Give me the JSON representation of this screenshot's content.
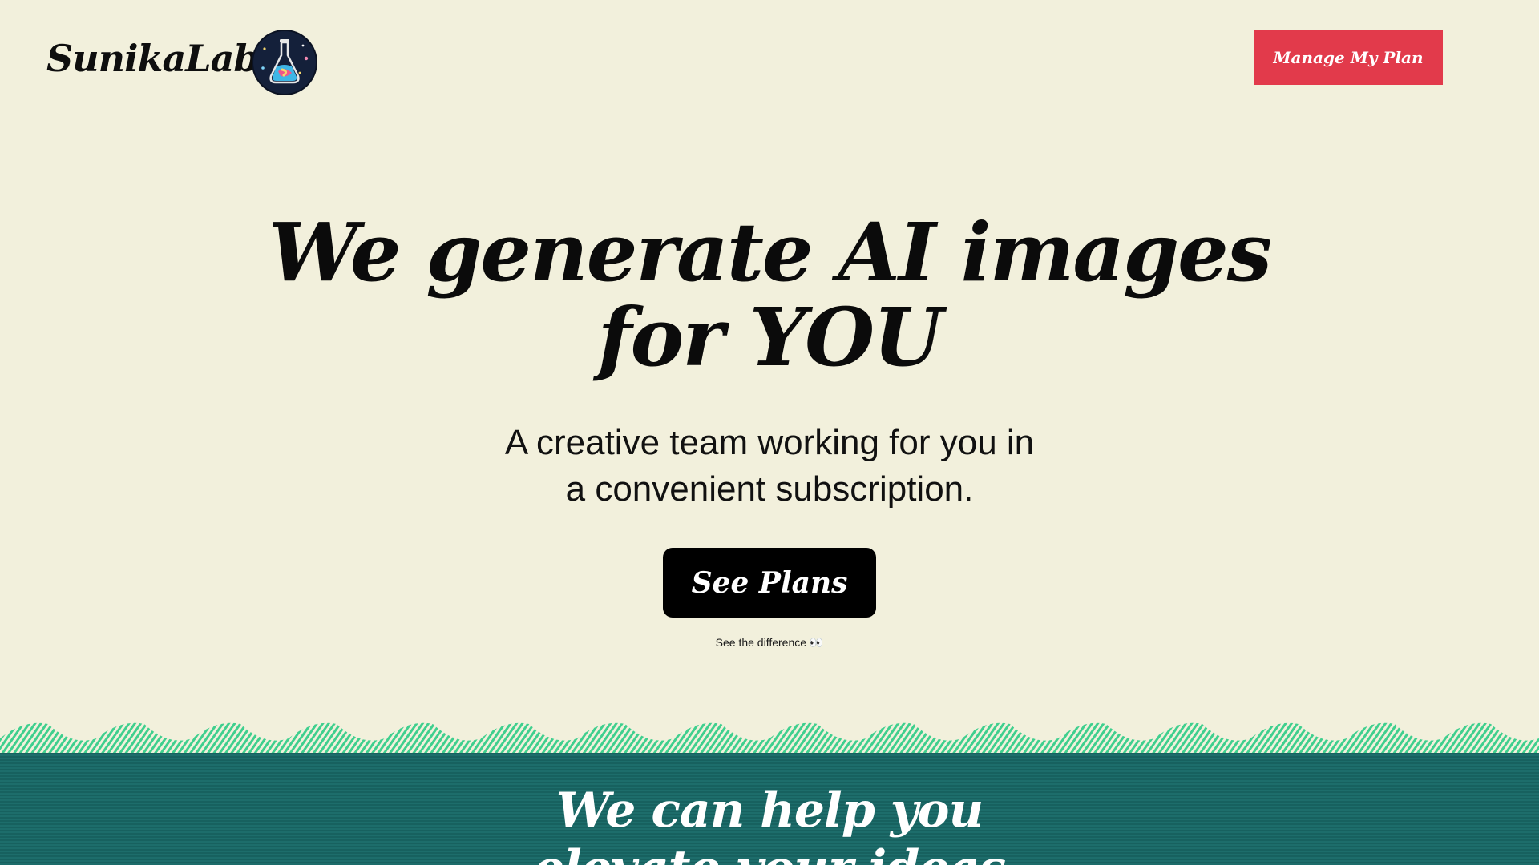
{
  "header": {
    "brand": "SunikaLabs",
    "logo_icon": "flask-icon",
    "manage_plan_label": "Manage My Plan"
  },
  "hero": {
    "title_line1": "We generate AI images",
    "title_line2": "for YOU",
    "subtitle_line1": "A creative team working for you in",
    "subtitle_line2": "a convenient subscription.",
    "cta_label": "See Plans",
    "difference_link": "See the difference 👀"
  },
  "section": {
    "title_line1": "We can help you",
    "title_line2": "elevate your ideas"
  },
  "colors": {
    "background": "#f2f0dc",
    "accent_red": "#e23a4b",
    "cta_black": "#000000",
    "band_teal": "#17615f",
    "wave_green": "#3fcf8e"
  }
}
